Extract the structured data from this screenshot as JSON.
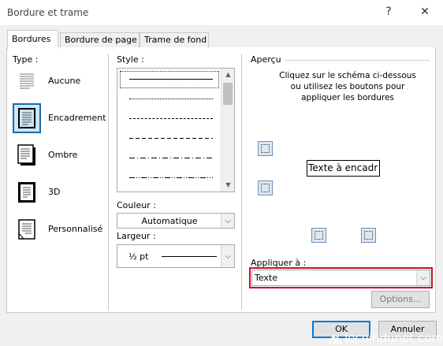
{
  "window": {
    "title": "Bordure et trame",
    "help_label": "?",
    "close_label": "✕"
  },
  "tabs": [
    {
      "label": "Bordures",
      "active": true
    },
    {
      "label": "Bordure de page",
      "active": false
    },
    {
      "label": "Trame de fond",
      "active": false
    }
  ],
  "type_section": {
    "label": "Type :",
    "items": [
      {
        "label": "Aucune",
        "icon": "border-none-icon",
        "selected": false
      },
      {
        "label": "Encadrement",
        "icon": "border-box-icon",
        "selected": true
      },
      {
        "label": "Ombre",
        "icon": "border-shadow-icon",
        "selected": false
      },
      {
        "label": "3D",
        "icon": "border-3d-icon",
        "selected": false
      },
      {
        "label": "Personnalisé",
        "icon": "border-custom-icon",
        "selected": false
      }
    ]
  },
  "style_section": {
    "label": "Style :",
    "selected_index": 0
  },
  "color": {
    "label": "Couleur :",
    "value": "Automatique"
  },
  "width": {
    "label": "Largeur :",
    "value": "½ pt"
  },
  "preview": {
    "label": "Aperçu",
    "instructions": "Cliquez sur le schéma ci-dessous ou utilisez les boutons pour appliquer les bordures",
    "sample_text": "Texte à encadr"
  },
  "apply_to": {
    "label": "Appliquer à :",
    "value": "Texte",
    "highlight_color": "#c8102e"
  },
  "buttons": {
    "options": "Options...",
    "ok": "OK",
    "cancel": "Annuler"
  },
  "watermark": "lecoindunet.com",
  "colors": {
    "selected_border": "#1b6ca8",
    "ok_border": "#0078d7"
  }
}
